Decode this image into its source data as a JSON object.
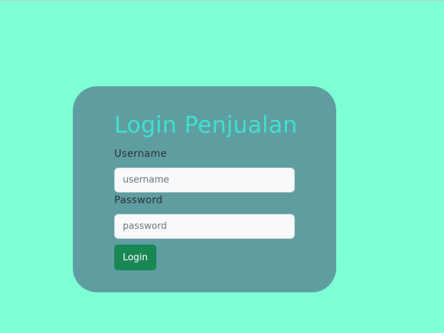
{
  "login": {
    "title": "Login Penjualan",
    "username_label": "Username",
    "username_placeholder": "username",
    "username_value": "",
    "password_label": "Password",
    "password_placeholder": "password",
    "password_value": "",
    "submit_label": "Login"
  },
  "colors": {
    "page_background": "#7fffd4",
    "card_background": "#5f9ea0",
    "title": "#40e0d0",
    "button": "#198754"
  }
}
